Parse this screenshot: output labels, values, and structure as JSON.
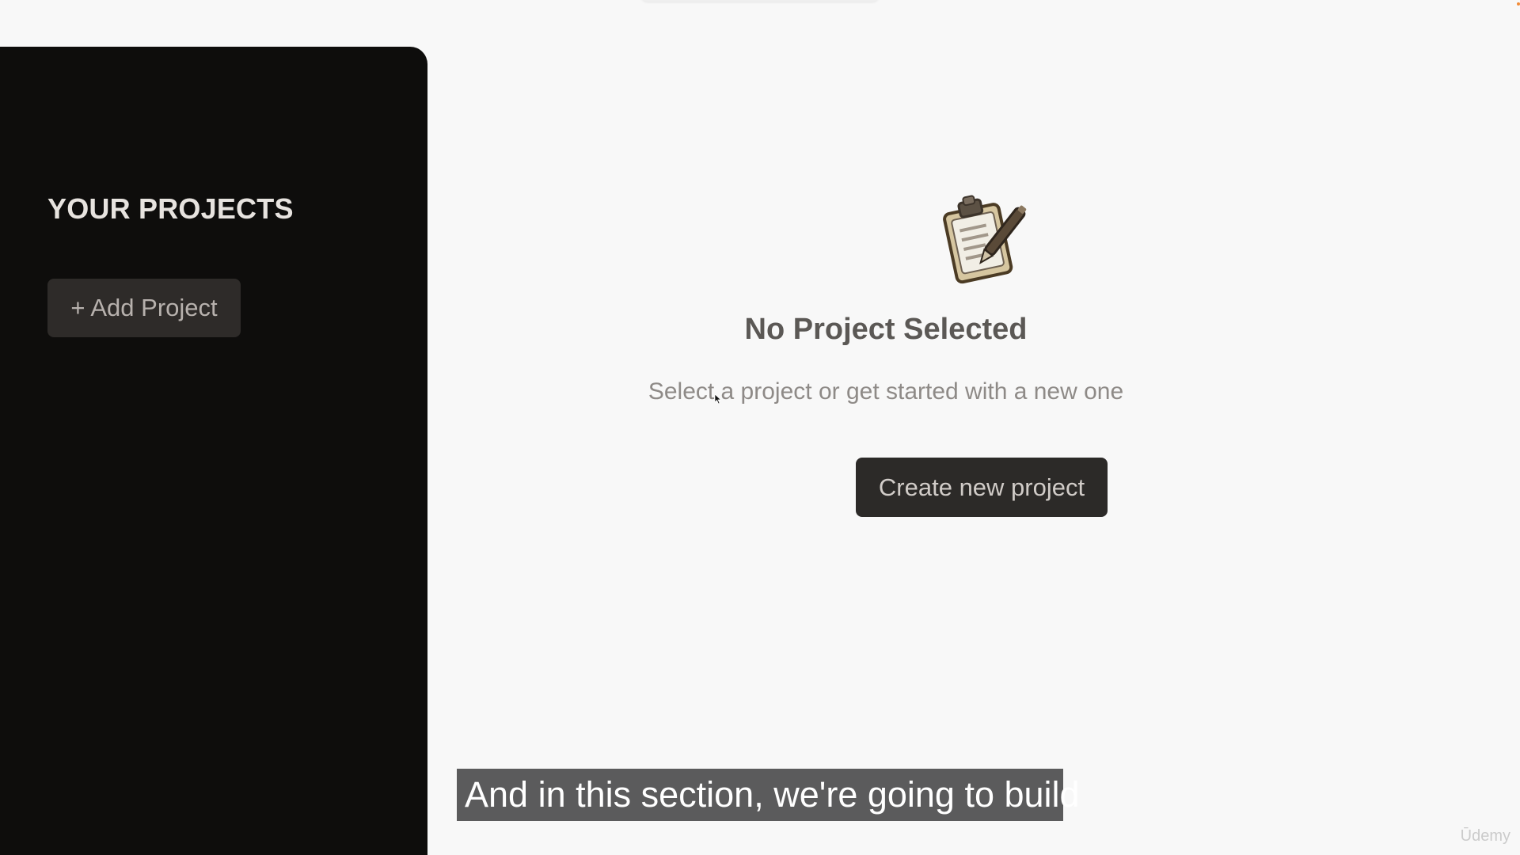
{
  "sidebar": {
    "title": "YOUR PROJECTS",
    "add_button_label": "+ Add Project"
  },
  "main": {
    "empty_icon": "clipboard-pen-icon",
    "title": "No Project Selected",
    "subtitle": "Select a project or get started with a new one",
    "create_button_label": "Create new project"
  },
  "overlay": {
    "caption": "And in this section, we're going to build",
    "watermark": "Ūdemy"
  },
  "colors": {
    "page_background": "#f8f8f8",
    "sidebar_background": "#0e0d0c",
    "button_background": "#2c2a28",
    "caption_background": "#5b5b5c"
  }
}
